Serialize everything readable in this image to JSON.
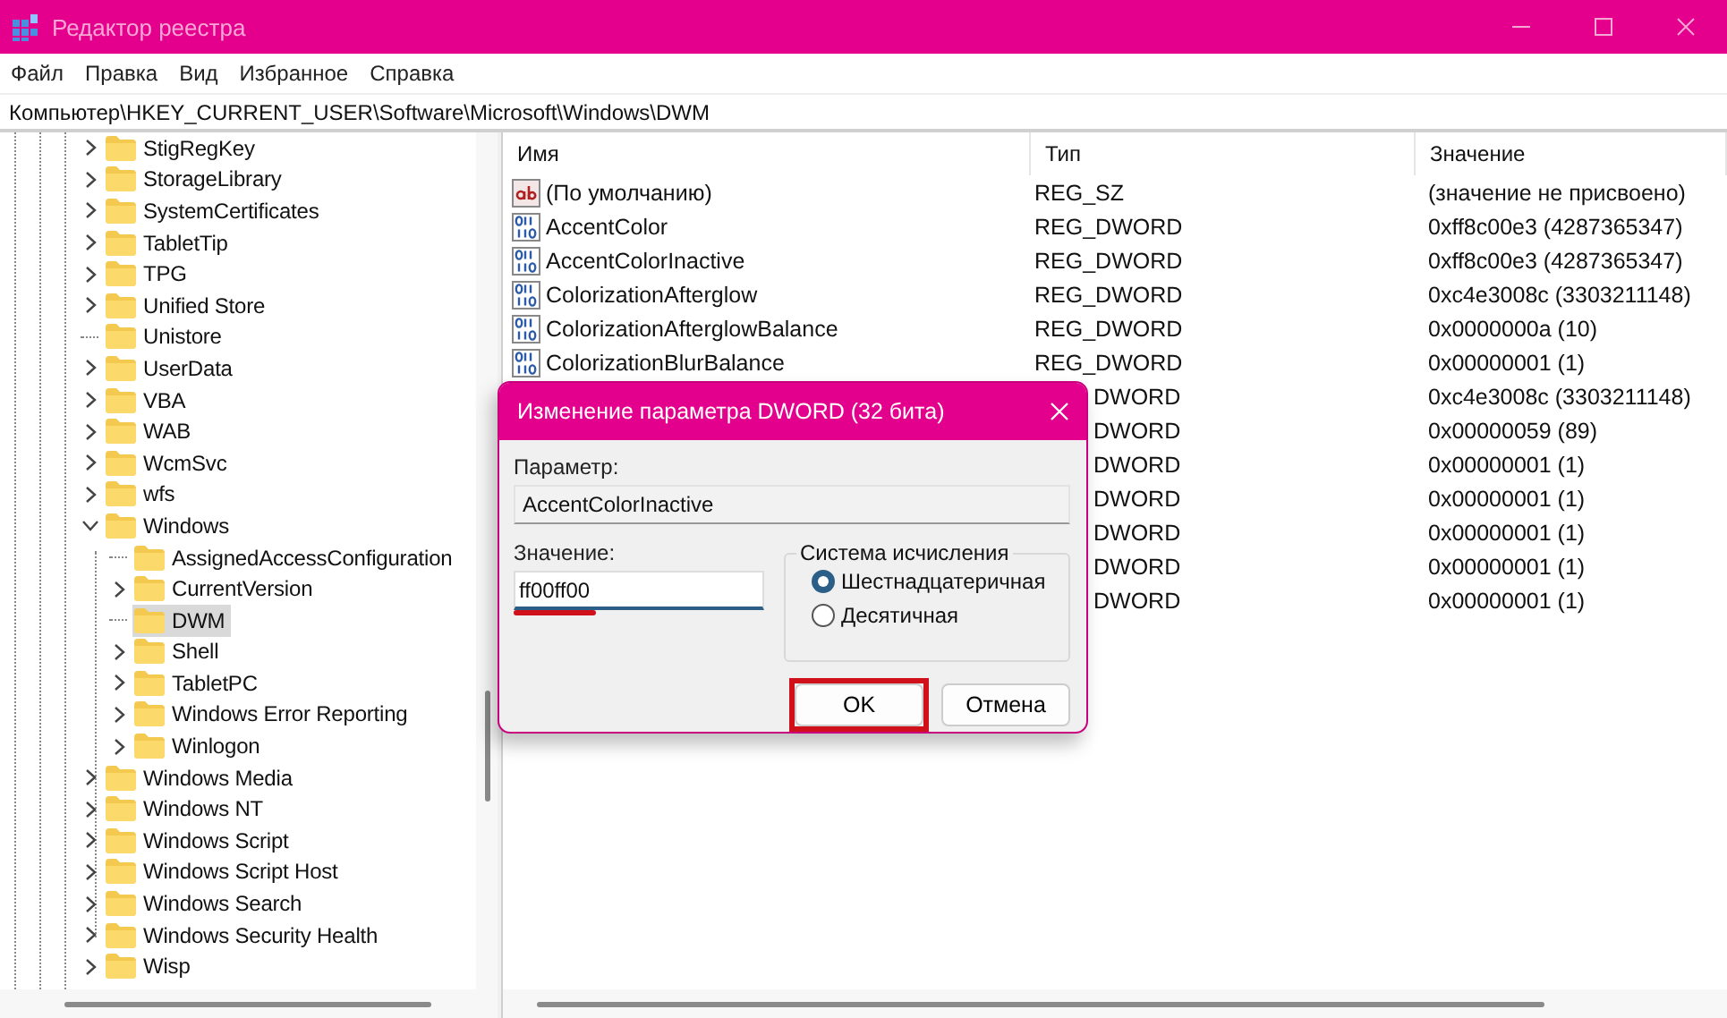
{
  "window": {
    "title": "Редактор реестра"
  },
  "menu": [
    "Файл",
    "Правка",
    "Вид",
    "Избранное",
    "Справка"
  ],
  "address": "Компьютер\\HKEY_CURRENT_USER\\Software\\Microsoft\\Windows\\DWM",
  "tree": [
    {
      "label": "StigRegKey",
      "has_children": true,
      "expanded": false,
      "selected": false
    },
    {
      "label": "StorageLibrary",
      "has_children": true,
      "expanded": false,
      "selected": false
    },
    {
      "label": "SystemCertificates",
      "has_children": true,
      "expanded": false,
      "selected": false
    },
    {
      "label": "TabletTip",
      "has_children": true,
      "expanded": false,
      "selected": false
    },
    {
      "label": "TPG",
      "has_children": true,
      "expanded": false,
      "selected": false
    },
    {
      "label": "Unified Store",
      "has_children": true,
      "expanded": false,
      "selected": false
    },
    {
      "label": "Unistore",
      "has_children": false,
      "selected": false
    },
    {
      "label": "UserData",
      "has_children": true,
      "expanded": false,
      "selected": false
    },
    {
      "label": "VBA",
      "has_children": true,
      "expanded": false,
      "selected": false
    },
    {
      "label": "WAB",
      "has_children": true,
      "expanded": false,
      "selected": false
    },
    {
      "label": "WcmSvc",
      "has_children": true,
      "expanded": false,
      "selected": false
    },
    {
      "label": "wfs",
      "has_children": true,
      "expanded": false,
      "selected": false
    },
    {
      "label": "Windows",
      "has_children": true,
      "expanded": true,
      "selected": false,
      "children": [
        {
          "label": "AssignedAccessConfiguration",
          "has_children": false,
          "selected": false
        },
        {
          "label": "CurrentVersion",
          "has_children": true,
          "expanded": false,
          "selected": false
        },
        {
          "label": "DWM",
          "has_children": false,
          "selected": true
        },
        {
          "label": "Shell",
          "has_children": true,
          "expanded": false,
          "selected": false
        },
        {
          "label": "TabletPC",
          "has_children": true,
          "expanded": false,
          "selected": false
        },
        {
          "label": "Windows Error Reporting",
          "has_children": true,
          "expanded": false,
          "selected": false
        },
        {
          "label": "Winlogon",
          "has_children": true,
          "expanded": false,
          "selected": false
        }
      ]
    },
    {
      "label": "Windows Media",
      "has_children": true,
      "expanded": false,
      "selected": false
    },
    {
      "label": "Windows NT",
      "has_children": true,
      "expanded": false,
      "selected": false
    },
    {
      "label": "Windows Script",
      "has_children": true,
      "expanded": false,
      "selected": false
    },
    {
      "label": "Windows Script Host",
      "has_children": true,
      "expanded": false,
      "selected": false
    },
    {
      "label": "Windows Search",
      "has_children": true,
      "expanded": false,
      "selected": false
    },
    {
      "label": "Windows Security Health",
      "has_children": true,
      "expanded": false,
      "selected": false
    },
    {
      "label": "Wisp",
      "has_children": true,
      "expanded": false,
      "selected": false
    }
  ],
  "values": {
    "columns": [
      "Имя",
      "Тип",
      "Значение"
    ],
    "rows": [
      {
        "kind": "string",
        "name": "(По умолчанию)",
        "type": "REG_SZ",
        "value": "(значение не присвоено)"
      },
      {
        "kind": "dword",
        "name": "AccentColor",
        "type": "REG_DWORD",
        "value": "0xff8c00e3 (4287365347)"
      },
      {
        "kind": "dword",
        "name": "AccentColorInactive",
        "type": "REG_DWORD",
        "value": "0xff8c00e3 (4287365347)"
      },
      {
        "kind": "dword",
        "name": "ColorizationAfterglow",
        "type": "REG_DWORD",
        "value": "0xc4e3008c (3303211148)"
      },
      {
        "kind": "dword",
        "name": "ColorizationAfterglowBalance",
        "type": "REG_DWORD",
        "value": "0x0000000a (10)"
      },
      {
        "kind": "dword",
        "name": "ColorizationBlurBalance",
        "type": "REG_DWORD",
        "value": "0x00000001 (1)"
      },
      {
        "kind": "covered",
        "type": "DWORD",
        "value": "0xc4e3008c (3303211148)"
      },
      {
        "kind": "covered",
        "type": "DWORD",
        "value": "0x00000059 (89)"
      },
      {
        "kind": "covered",
        "type": "DWORD",
        "value": "0x00000001 (1)"
      },
      {
        "kind": "covered",
        "type": "DWORD",
        "value": "0x00000001 (1)"
      },
      {
        "kind": "covered",
        "type": "DWORD",
        "value": "0x00000001 (1)"
      },
      {
        "kind": "covered",
        "type": "DWORD",
        "value": "0x00000001 (1)"
      },
      {
        "kind": "covered",
        "type": "DWORD",
        "value": "0x00000001 (1)"
      }
    ]
  },
  "dialog": {
    "title": "Изменение параметра DWORD (32 бита)",
    "param_label": "Параметр:",
    "param_value": "AccentColorInactive",
    "value_label": "Значение:",
    "value": "ff00ff00",
    "value_underlined": true,
    "base_label": "Система исчисления",
    "bases": [
      {
        "label": "Шестнадцатеричная",
        "selected": true
      },
      {
        "label": "Десятичная",
        "selected": false
      }
    ],
    "buttons": [
      {
        "label": "OK",
        "highlighted": true
      },
      {
        "label": "Отмена",
        "highlighted": false
      }
    ]
  }
}
